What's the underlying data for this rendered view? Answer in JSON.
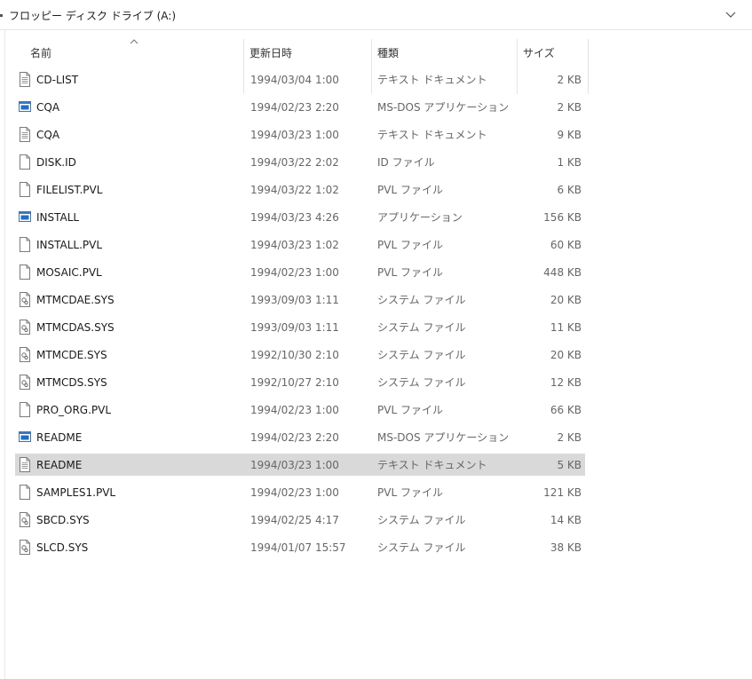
{
  "address": {
    "path": "フロッピー ディスク ドライブ (A:)"
  },
  "columns": {
    "name": "名前",
    "date": "更新日時",
    "type": "種類",
    "size": "サイズ"
  },
  "files": [
    {
      "name": "CD-LIST",
      "date": "1994/03/04 1:00",
      "type": "テキスト ドキュメント",
      "size": "2 KB",
      "icon": "text-file-icon"
    },
    {
      "name": "CQA",
      "date": "1994/02/23 2:20",
      "type": "MS-DOS アプリケーション",
      "size": "2 KB",
      "icon": "application-icon"
    },
    {
      "name": "CQA",
      "date": "1994/03/23 1:00",
      "type": "テキスト ドキュメント",
      "size": "9 KB",
      "icon": "text-file-icon"
    },
    {
      "name": "DISK.ID",
      "date": "1994/03/22 2:02",
      "type": "ID ファイル",
      "size": "1 KB",
      "icon": "file-icon"
    },
    {
      "name": "FILELIST.PVL",
      "date": "1994/03/22 1:02",
      "type": "PVL ファイル",
      "size": "6 KB",
      "icon": "file-icon"
    },
    {
      "name": "INSTALL",
      "date": "1994/03/23 4:26",
      "type": "アプリケーション",
      "size": "156 KB",
      "icon": "application-icon"
    },
    {
      "name": "INSTALL.PVL",
      "date": "1994/03/23 1:02",
      "type": "PVL ファイル",
      "size": "60 KB",
      "icon": "file-icon"
    },
    {
      "name": "MOSAIC.PVL",
      "date": "1994/02/23 1:00",
      "type": "PVL ファイル",
      "size": "448 KB",
      "icon": "file-icon"
    },
    {
      "name": "MTMCDAE.SYS",
      "date": "1993/09/03 1:11",
      "type": "システム ファイル",
      "size": "20 KB",
      "icon": "system-file-icon"
    },
    {
      "name": "MTMCDAS.SYS",
      "date": "1993/09/03 1:11",
      "type": "システム ファイル",
      "size": "11 KB",
      "icon": "system-file-icon"
    },
    {
      "name": "MTMCDE.SYS",
      "date": "1992/10/30 2:10",
      "type": "システム ファイル",
      "size": "20 KB",
      "icon": "system-file-icon"
    },
    {
      "name": "MTMCDS.SYS",
      "date": "1992/10/27 2:10",
      "type": "システム ファイル",
      "size": "12 KB",
      "icon": "system-file-icon"
    },
    {
      "name": "PRO_ORG.PVL",
      "date": "1994/02/23 1:00",
      "type": "PVL ファイル",
      "size": "66 KB",
      "icon": "file-icon"
    },
    {
      "name": "README",
      "date": "1994/02/23 2:20",
      "type": "MS-DOS アプリケーション",
      "size": "2 KB",
      "icon": "application-icon"
    },
    {
      "name": "README",
      "date": "1994/03/23 1:00",
      "type": "テキスト ドキュメント",
      "size": "5 KB",
      "icon": "text-file-icon",
      "selected": true
    },
    {
      "name": "SAMPLES1.PVL",
      "date": "1994/02/23 1:00",
      "type": "PVL ファイル",
      "size": "121 KB",
      "icon": "file-icon"
    },
    {
      "name": "SBCD.SYS",
      "date": "1994/02/25 4:17",
      "type": "システム ファイル",
      "size": "14 KB",
      "icon": "system-file-icon"
    },
    {
      "name": "SLCD.SYS",
      "date": "1994/01/07 15:57",
      "type": "システム ファイル",
      "size": "38 KB",
      "icon": "system-file-icon"
    }
  ],
  "colors": {
    "selected_row": "#d9d9d9",
    "app_icon_blue": "#1e6fc4"
  }
}
